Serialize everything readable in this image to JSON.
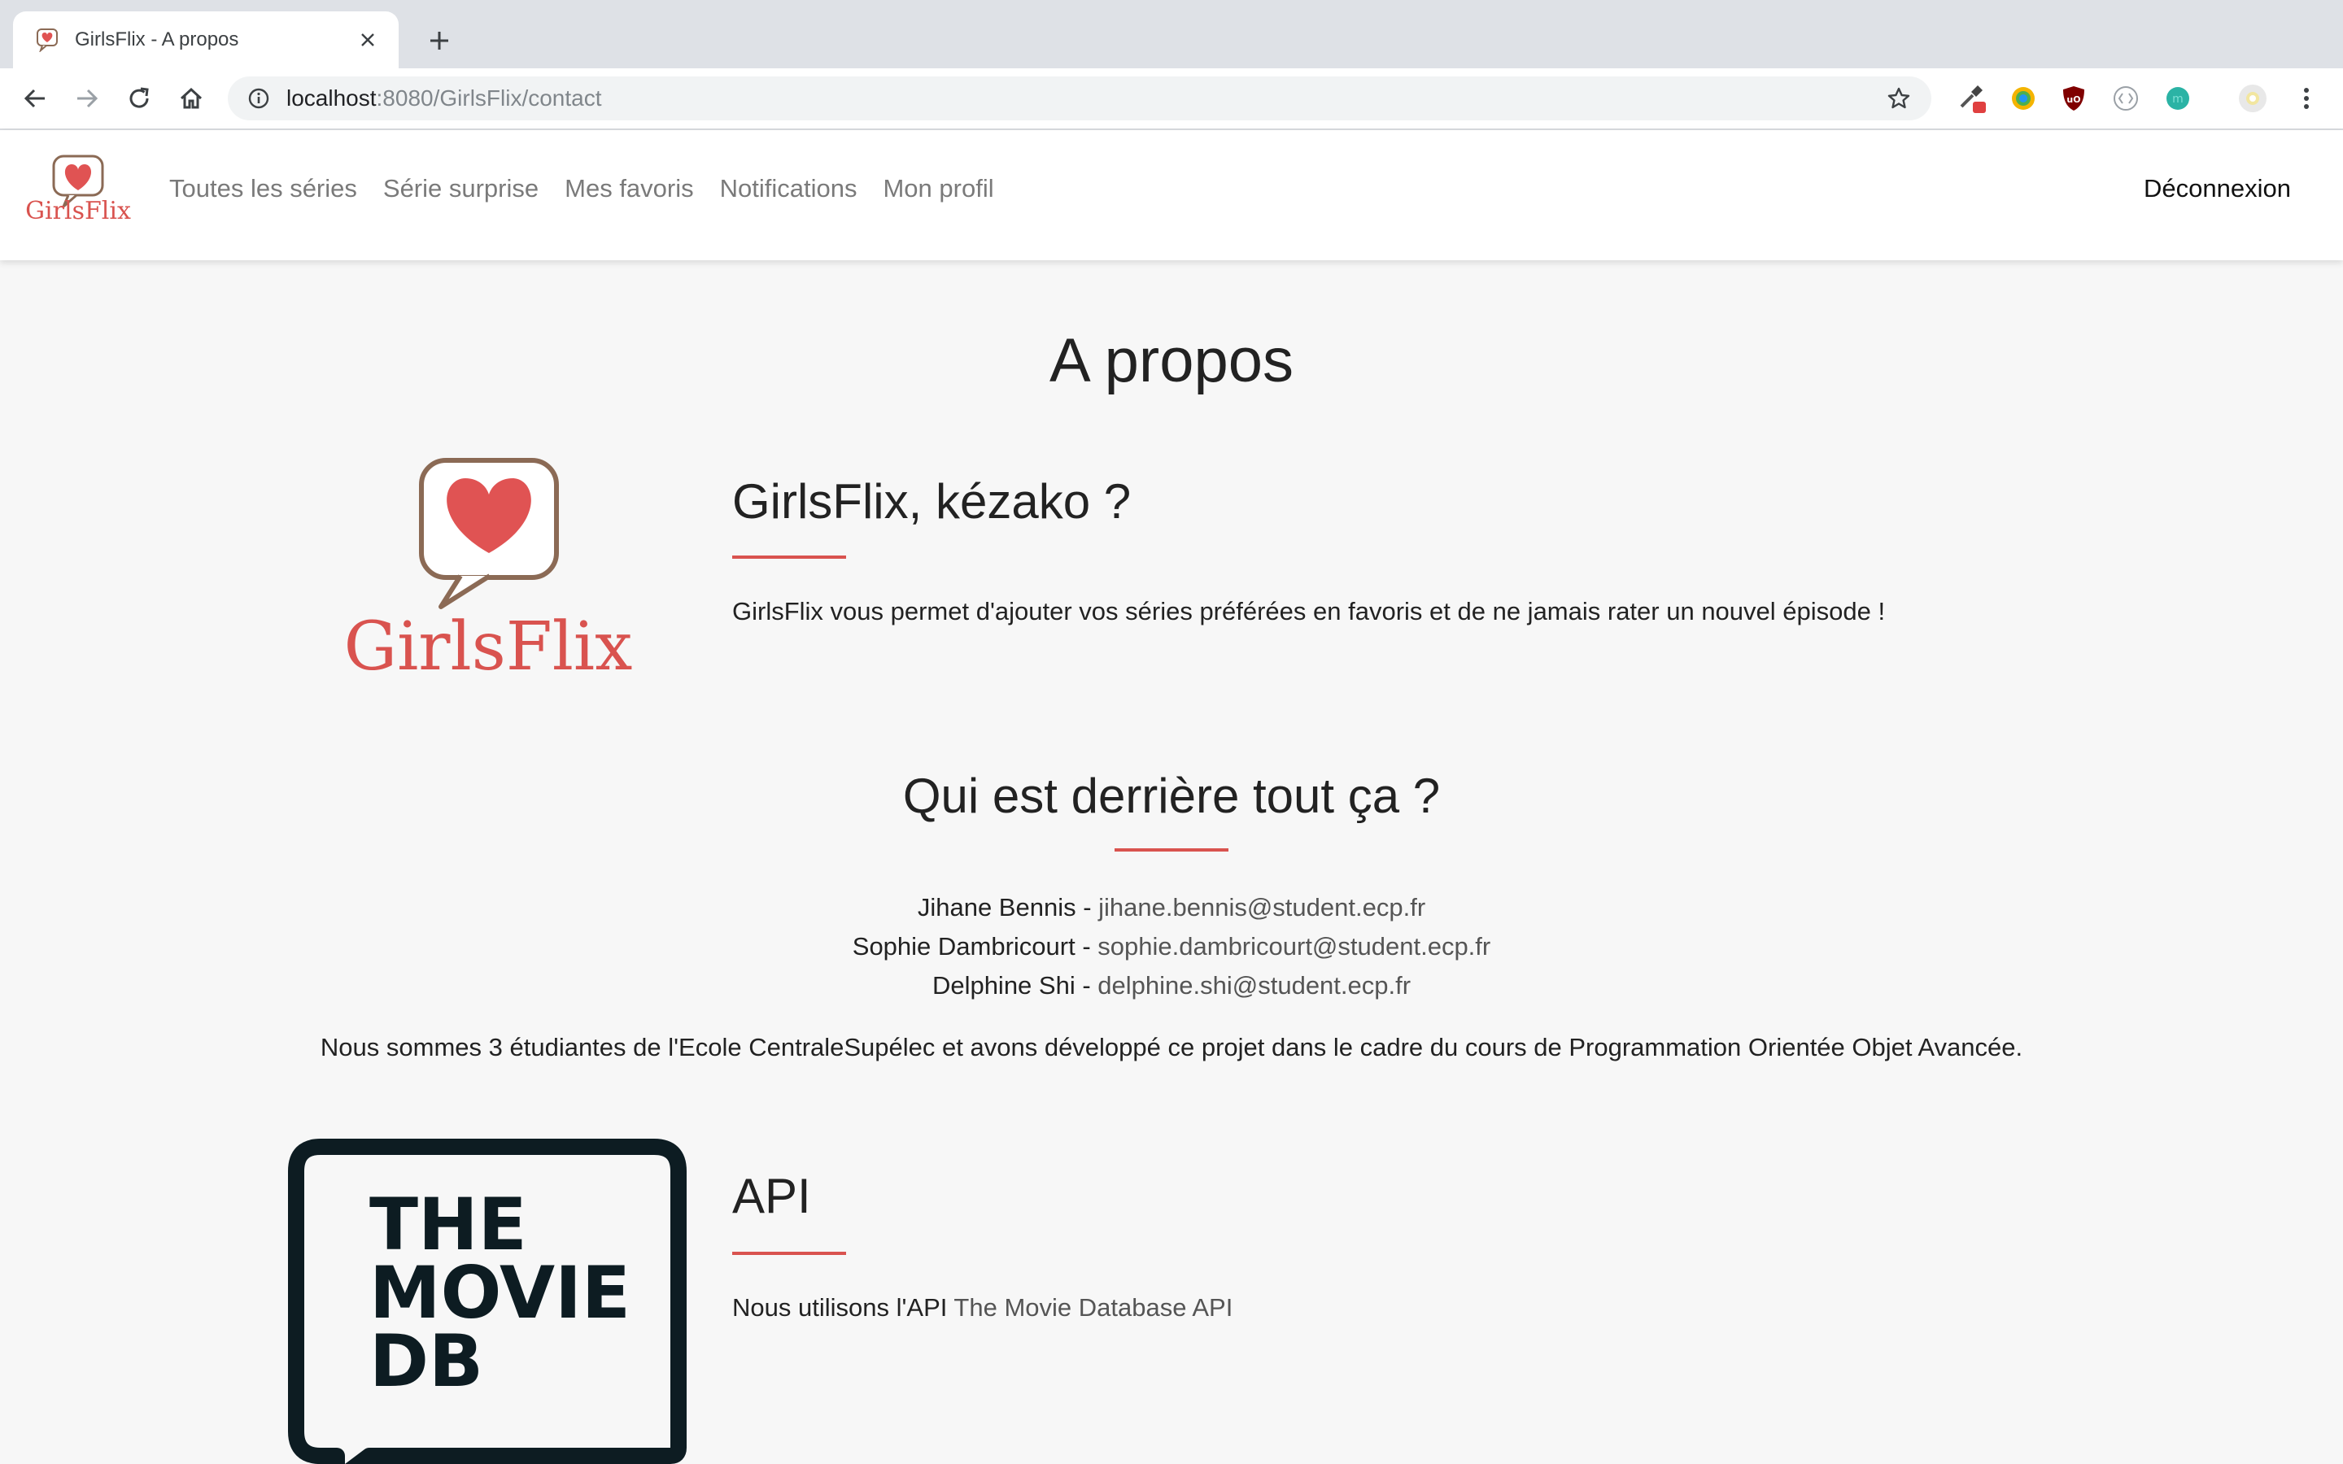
{
  "browser": {
    "tab_title": "GirlsFlix - A propos",
    "url_host": "localhost",
    "url_path": ":8080/GirlsFlix/contact"
  },
  "nav": {
    "brand": "GirlsFlix",
    "links": [
      "Toutes les séries",
      "Série surprise",
      "Mes favoris",
      "Notifications",
      "Mon profil"
    ],
    "logout": "Déconnexion"
  },
  "page": {
    "title": "A propos",
    "logo_text": "GirlsFlix"
  },
  "section_about": {
    "title": "GirlsFlix, kézako ?",
    "text": "GirlsFlix vous permet d'ajouter vos séries préférées en favoris et de ne jamais rater un nouvel épisode !"
  },
  "section_team": {
    "title": "Qui est derrière tout ça ?",
    "members": [
      {
        "name": "Jihane Bennis",
        "email": "jihane.bennis@student.ecp.fr"
      },
      {
        "name": "Sophie Dambricourt",
        "email": "sophie.dambricourt@student.ecp.fr"
      },
      {
        "name": "Delphine Shi",
        "email": "delphine.shi@student.ecp.fr"
      }
    ],
    "separator": " - ",
    "description": "Nous sommes 3 étudiantes de l'Ecole CentraleSupélec et avons développé ce projet dans le cadre du cours de Programmation Orientée Objet Avancée."
  },
  "section_api": {
    "title": "API",
    "text_prefix": "Nous utilisons l'API ",
    "link": "The Movie Database API",
    "logo_lines": [
      "THE",
      "MOVIE",
      "DB"
    ]
  },
  "colors": {
    "accent": "#d9534f",
    "logo_outline": "#8b6a55",
    "tmdb_dark": "#0d1c22"
  }
}
